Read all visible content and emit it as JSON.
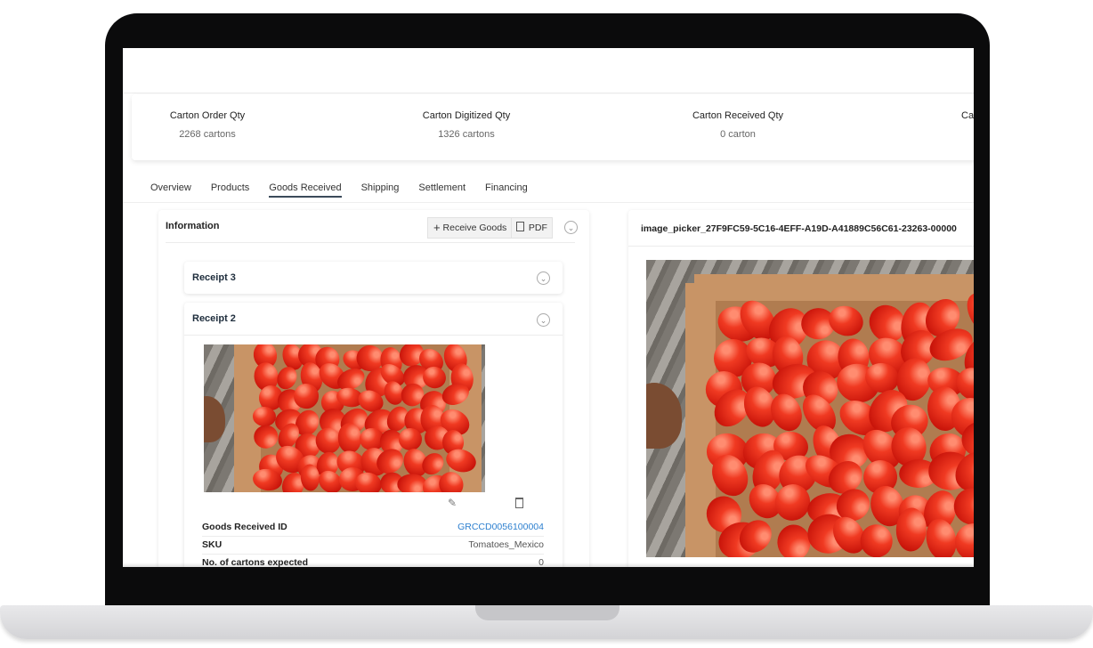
{
  "summary": [
    {
      "label": "Carton Order Qty",
      "value": "2268 cartons"
    },
    {
      "label": "Carton Digitized Qty",
      "value": "1326 cartons"
    },
    {
      "label": "Carton Received Qty",
      "value": "0 carton"
    },
    {
      "label": "Ca",
      "value": ""
    }
  ],
  "tabs": [
    "Overview",
    "Products",
    "Goods Received",
    "Shipping",
    "Settlement",
    "Financing"
  ],
  "active_tab": "Goods Received",
  "info_panel": {
    "title": "Information",
    "receive_label": "Receive Goods",
    "pdf_label": "PDF"
  },
  "receipts": [
    {
      "title": "Receipt 3"
    },
    {
      "title": "Receipt 2"
    }
  ],
  "receipt_details": [
    {
      "key": "Goods Received ID",
      "value": "GRCCD0056100004"
    },
    {
      "key": "SKU",
      "value": "Tomatoes_Mexico"
    },
    {
      "key": "No. of cartons expected",
      "value": "0"
    }
  ],
  "image_viewer": {
    "title": "image_picker_27F9FC59-5C16-4EFF-A19D-A41889C56C61-23263-00000"
  },
  "icons": {
    "collapse": "chevron-down-circle-icon",
    "plus": "plus-icon",
    "pdf": "file-icon",
    "edit": "edit-icon",
    "delete": "trash-icon"
  },
  "colors": {
    "link": "#2c7fcf",
    "tab_underline": "#3b4a5a"
  }
}
